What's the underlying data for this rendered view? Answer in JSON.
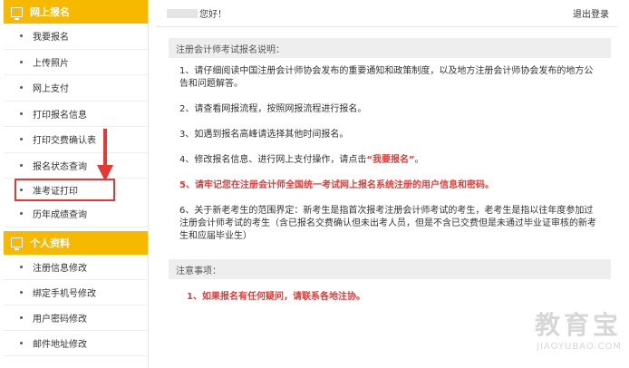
{
  "sidebar": {
    "section1": {
      "title": "网上报名",
      "items": [
        "我要报名",
        "上传照片",
        "网上支付",
        "打印报名信息",
        "打印交费确认表",
        "报名状态查询",
        "准考证打印",
        "历年成绩查询"
      ]
    },
    "section2": {
      "title": "个人资料",
      "items": [
        "注册信息修改",
        "绑定手机号修改",
        "用户密码修改",
        "邮件地址修改"
      ]
    }
  },
  "topbar": {
    "greeting": "您好！",
    "logout": "退出登录"
  },
  "instructions": {
    "title": "注册会计师考试报名说明：",
    "items": [
      "1、请仔细阅读中国注册会计师协会发布的重要通知和政策制度，以及地方注册会计师协会发布的地方公告和问题解答。",
      "2、请查看网报流程，按照网报流程进行报名。",
      "3、如遇到报名高峰请选择其他时间报名。",
      {
        "prefix": "4、修改报名信息、进行网上支付操作，请点击",
        "link": "“我要报名”",
        "suffix": "。"
      },
      "5、请牢记您在注册会计师全国统一考试网上报名系统注册的用户信息和密码。",
      "6、关于新老考生的范围界定：新考生是指首次报考注册会计师考试的考生，老考生是指以往年度参加过注册会计师考试的考生（含已报名交费确认但未出考人员，但是不含已交费但是未通过毕业证审核的新考生和应届毕业生）"
    ]
  },
  "notice": {
    "title": "注意事项：",
    "item": "1、如果报名有任何疑问，请联系各地注协。"
  },
  "watermark": {
    "main": "教育宝",
    "sub": "JIAOYUBAO.COM"
  },
  "colors": {
    "accent": "#f7b800",
    "highlight": "#e53935"
  },
  "icons": {
    "section1": "monitor-icon",
    "section2": "id-card-icon",
    "annotation": "red-arrow-icon"
  }
}
